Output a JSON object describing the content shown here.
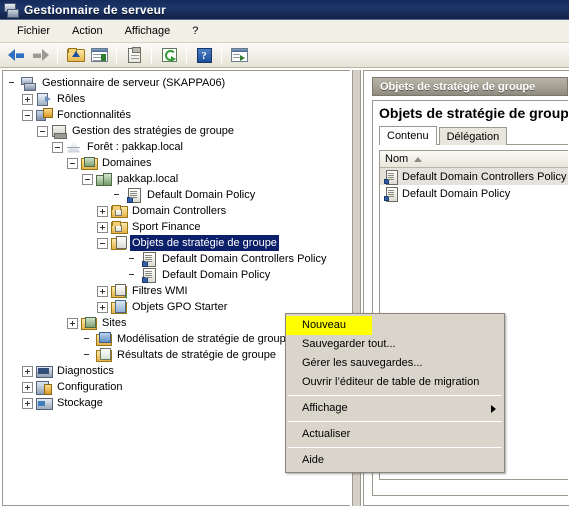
{
  "window": {
    "title": "Gestionnaire de serveur",
    "icon": "server-icon"
  },
  "menubar": {
    "items": [
      {
        "label": "Fichier",
        "name": "menu-fichier"
      },
      {
        "label": "Action",
        "name": "menu-action"
      },
      {
        "label": "Affichage",
        "name": "menu-affichage"
      },
      {
        "label": "?",
        "name": "menu-help"
      }
    ]
  },
  "toolbar": {
    "buttons": [
      {
        "name": "back-button",
        "icon": "arrow-left-icon"
      },
      {
        "name": "forward-button",
        "icon": "arrow-right-icon"
      },
      {
        "name": "up-one-level-button",
        "icon": "folder-up-icon"
      },
      {
        "name": "show-hide-console-tree-button",
        "icon": "panel-icon"
      },
      {
        "name": "properties-button",
        "icon": "clipboard-icon"
      },
      {
        "name": "refresh-button",
        "icon": "refresh-icon"
      },
      {
        "name": "help-button",
        "icon": "question-mark-icon"
      },
      {
        "name": "show-hide-action-pane-button",
        "icon": "panel-go-icon"
      }
    ]
  },
  "tree": {
    "nodes": [
      {
        "label": "Gestionnaire de serveur (SKAPPA06)",
        "indent": 0,
        "toggle": "none",
        "icon": "ic-server",
        "name": "tree-item-server-manager",
        "selected": false
      },
      {
        "label": "Rôles",
        "indent": 1,
        "toggle": "plus",
        "icon": "ic-roles",
        "name": "tree-item-roles",
        "selected": false
      },
      {
        "label": "Fonctionnalités",
        "indent": 1,
        "toggle": "minus",
        "icon": "ic-feat",
        "name": "tree-item-features",
        "selected": false
      },
      {
        "label": "Gestion des stratégies de groupe",
        "indent": 2,
        "toggle": "minus",
        "icon": "ic-gpmc",
        "name": "tree-item-gpmc",
        "selected": false
      },
      {
        "label": "Forêt : pakkap.local",
        "indent": 3,
        "toggle": "minus",
        "icon": "ic-forest",
        "name": "tree-item-forest",
        "selected": false
      },
      {
        "label": "Domaines",
        "indent": 4,
        "toggle": "minus",
        "icon": "ic-domains",
        "name": "tree-item-domains",
        "selected": false
      },
      {
        "label": "pakkap.local",
        "indent": 5,
        "toggle": "minus",
        "icon": "ic-domain",
        "name": "tree-item-domain-pakkap",
        "selected": false
      },
      {
        "label": "Default Domain Policy",
        "indent": 7,
        "toggle": "none",
        "icon": "ic-gpo",
        "name": "tree-item-default-domain-policy",
        "selected": false
      },
      {
        "label": "Domain Controllers",
        "indent": 6,
        "toggle": "plus",
        "icon": "ic-ou",
        "name": "tree-item-domain-controllers",
        "selected": false
      },
      {
        "label": "Sport Finance",
        "indent": 6,
        "toggle": "plus",
        "icon": "ic-ou",
        "name": "tree-item-sport-finance",
        "selected": false
      },
      {
        "label": "Objets de stratégie de groupe",
        "indent": 6,
        "toggle": "minus",
        "icon": "ic-gpofolder",
        "name": "tree-item-gpo-container",
        "selected": true
      },
      {
        "label": "Default Domain Controllers Policy",
        "indent": 8,
        "toggle": "none",
        "icon": "ic-gpo",
        "name": "tree-item-ddc-policy",
        "selected": false
      },
      {
        "label": "Default Domain Policy",
        "indent": 8,
        "toggle": "none",
        "icon": "ic-gpo",
        "name": "tree-item-ddp-policy",
        "selected": false
      },
      {
        "label": "Filtres WMI",
        "indent": 6,
        "toggle": "plus",
        "icon": "ic-wmi",
        "name": "tree-item-wmi-filters",
        "selected": false
      },
      {
        "label": "Objets GPO Starter",
        "indent": 6,
        "toggle": "plus",
        "icon": "ic-starter",
        "name": "tree-item-starter-gpos",
        "selected": false
      },
      {
        "label": "Sites",
        "indent": 4,
        "toggle": "plus",
        "icon": "ic-sites",
        "name": "tree-item-sites",
        "selected": false
      },
      {
        "label": "Modélisation de stratégie de groupe",
        "indent": 5,
        "toggle": "none",
        "icon": "ic-model",
        "name": "tree-item-gp-modeling",
        "selected": false
      },
      {
        "label": "Résultats de stratégie de groupe",
        "indent": 5,
        "toggle": "none",
        "icon": "ic-results",
        "name": "tree-item-gp-results",
        "selected": false
      },
      {
        "label": "Diagnostics",
        "indent": 1,
        "toggle": "plus",
        "icon": "ic-diag",
        "name": "tree-item-diagnostics",
        "selected": false
      },
      {
        "label": "Configuration",
        "indent": 1,
        "toggle": "plus",
        "icon": "ic-config",
        "name": "tree-item-configuration",
        "selected": false
      },
      {
        "label": "Stockage",
        "indent": 1,
        "toggle": "plus",
        "icon": "ic-stock",
        "name": "tree-item-storage",
        "selected": false
      }
    ]
  },
  "right_pane": {
    "header_title": "Objets de stratégie de groupe",
    "body_title": "Objets de stratégie de groupe",
    "tabs": [
      {
        "label": "Contenu",
        "active": true,
        "name": "tab-contenu"
      },
      {
        "label": "Délégation",
        "active": false,
        "name": "tab-delegation"
      }
    ],
    "list": {
      "columns": [
        "Nom"
      ],
      "sort": "ascending",
      "rows": [
        {
          "name": "Default Domain Controllers Policy",
          "selected": true
        },
        {
          "name": "Default Domain Policy",
          "selected": false
        }
      ]
    }
  },
  "context_menu": {
    "items": [
      {
        "label": "Nouveau",
        "highlighted": true,
        "submenu": false,
        "name": "ctx-nouveau"
      },
      {
        "label": "Sauvegarder tout...",
        "highlighted": false,
        "submenu": false,
        "name": "ctx-sauvegarder-tout"
      },
      {
        "label": "Gérer les sauvegardes...",
        "highlighted": false,
        "submenu": false,
        "name": "ctx-gerer-sauvegardes"
      },
      {
        "label": "Ouvrir l’éditeur de table de migration",
        "highlighted": false,
        "submenu": false,
        "name": "ctx-ouvrir-editeur-migration"
      },
      {
        "separator": true
      },
      {
        "label": "Affichage",
        "highlighted": false,
        "submenu": true,
        "name": "ctx-affichage"
      },
      {
        "separator": true
      },
      {
        "label": "Actualiser",
        "highlighted": false,
        "submenu": false,
        "name": "ctx-actualiser"
      },
      {
        "separator": true
      },
      {
        "label": "Aide",
        "highlighted": false,
        "submenu": false,
        "name": "ctx-aide"
      }
    ]
  },
  "colors": {
    "titlebar": "#15295b",
    "selection": "#0b1f6b",
    "highlight": "#ffff00",
    "pane_header": "#a6a296",
    "chrome": "#f1efe6"
  }
}
